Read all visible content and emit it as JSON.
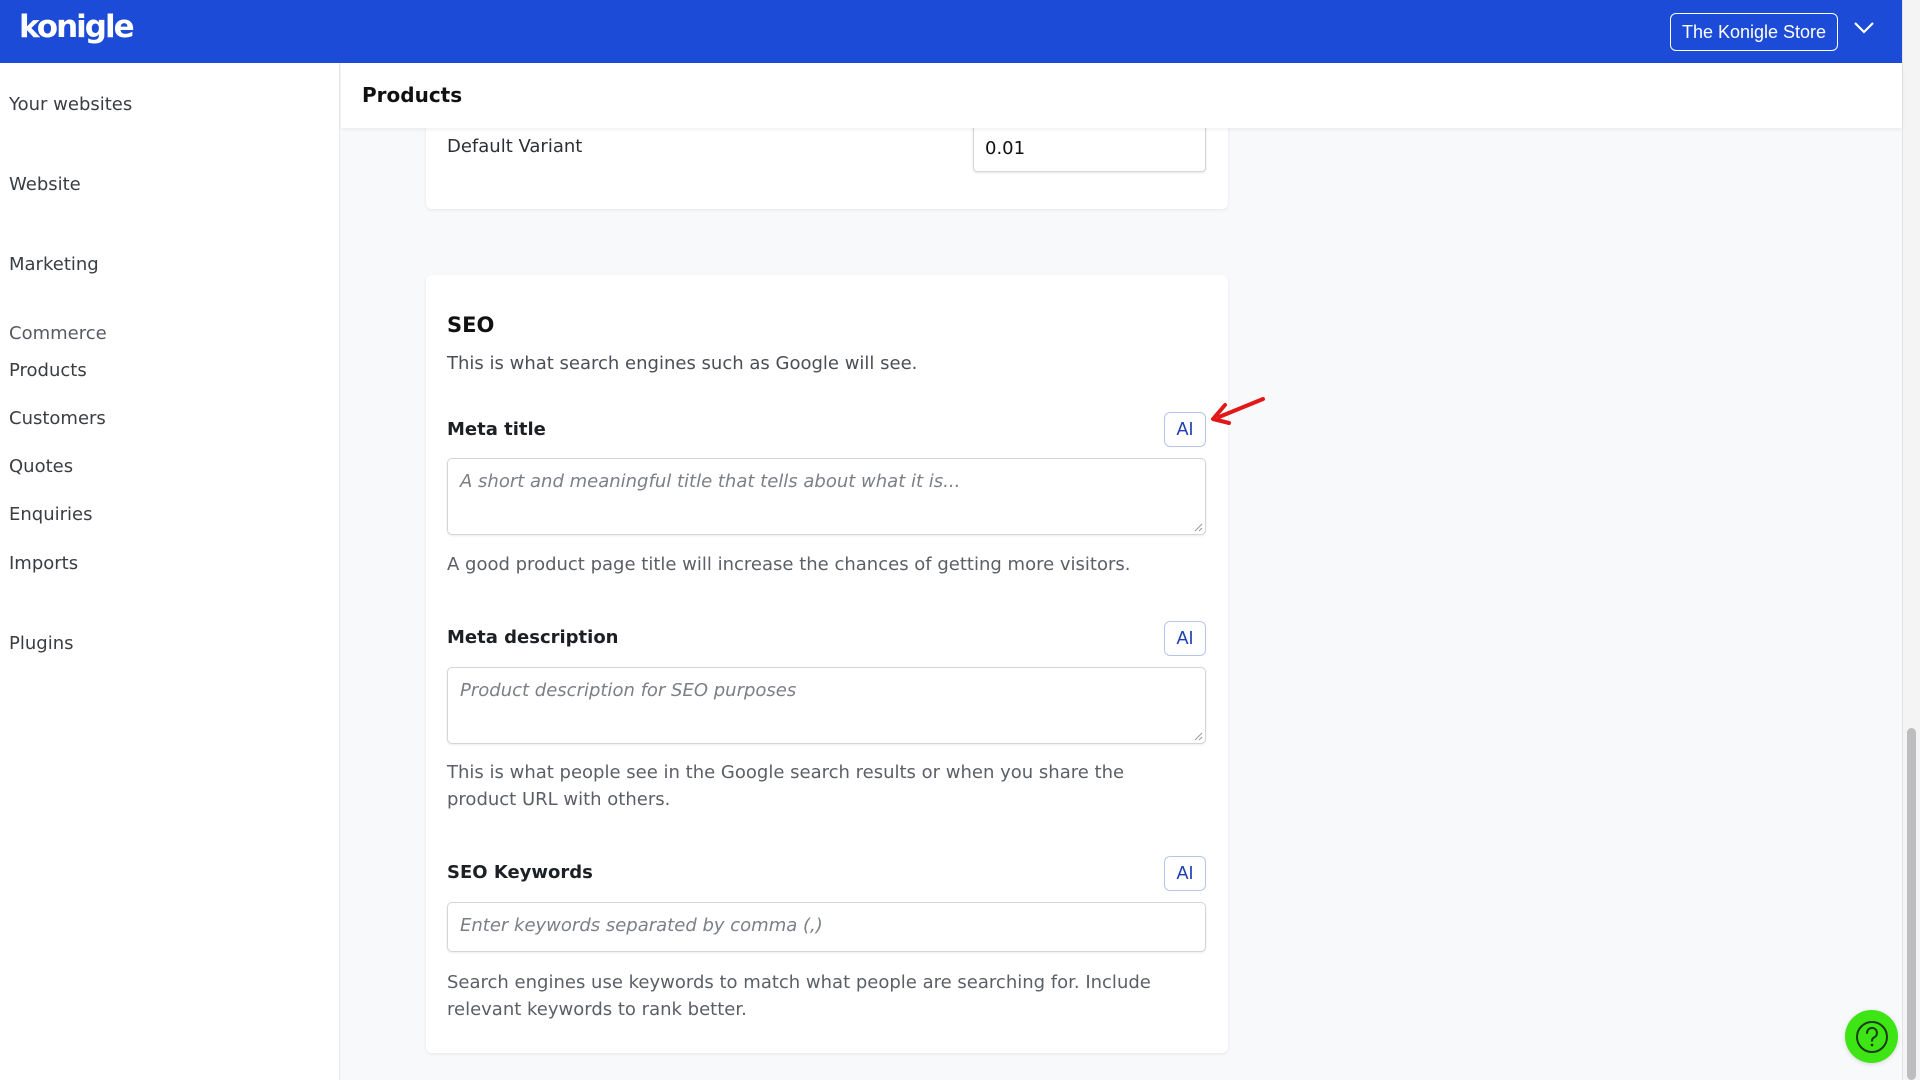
{
  "header": {
    "logo": "konigle",
    "store_button": "The Konigle Store",
    "brand_color": "#1c4bd8"
  },
  "sidebar": {
    "items": [
      {
        "label": "Your websites"
      },
      {
        "label": "Website"
      },
      {
        "label": "Marketing"
      },
      {
        "label": "Products"
      },
      {
        "label": "Customers"
      },
      {
        "label": "Quotes"
      },
      {
        "label": "Enquiries"
      },
      {
        "label": "Imports"
      },
      {
        "label": "Plugins"
      }
    ],
    "section_commerce": "Commerce"
  },
  "page": {
    "title": "Products"
  },
  "variant_card": {
    "label": "Default Variant",
    "value": "0.01"
  },
  "seo": {
    "title": "SEO",
    "description": "This is what search engines such as Google will see.",
    "ai_label": "AI",
    "meta_title": {
      "label": "Meta title",
      "placeholder": "A short and meaningful title that tells about what it is...",
      "help": "A good product page title will increase the chances of getting more visitors."
    },
    "meta_description": {
      "label": "Meta description",
      "placeholder": "Product description for SEO purposes",
      "help": "This is what people see in the Google search results or when you share the product URL with others."
    },
    "keywords": {
      "label": "SEO Keywords",
      "placeholder": "Enter keywords separated by comma (,)",
      "help": "Search engines use keywords to match what people are searching for. Include relevant keywords to rank better."
    }
  },
  "annotation": {
    "arrow_color": "#e01818"
  },
  "help_button": {
    "icon": "question-circle-icon",
    "color": "#3de514"
  }
}
